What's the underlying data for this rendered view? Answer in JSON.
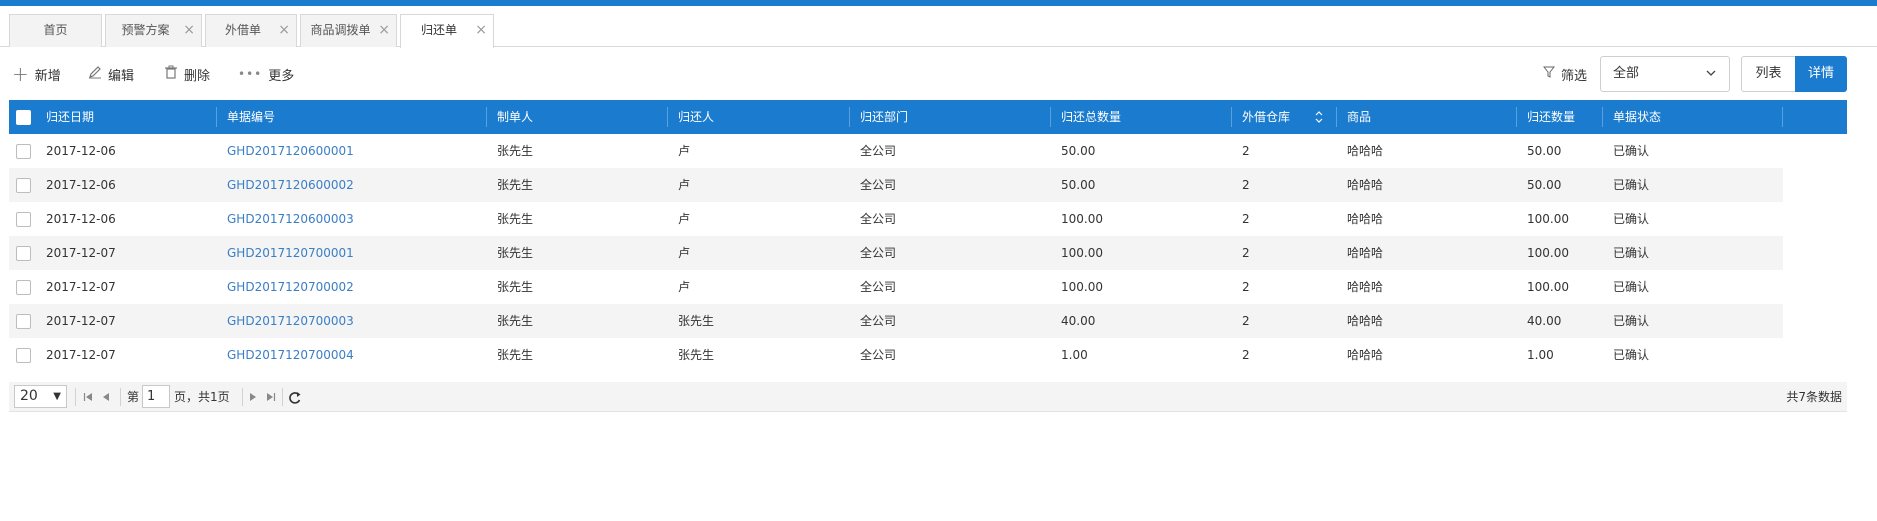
{
  "tabs": [
    {
      "label": "首页",
      "closable": false,
      "active": false
    },
    {
      "label": "预警方案",
      "closable": true,
      "active": false
    },
    {
      "label": "外借单",
      "closable": true,
      "active": false
    },
    {
      "label": "商品调拨单",
      "closable": true,
      "active": false
    },
    {
      "label": "归还单",
      "closable": true,
      "active": true
    }
  ],
  "toolbar": {
    "add_label": "新增",
    "edit_label": "编辑",
    "delete_label": "删除",
    "more_label": "更多",
    "filter_label": "筛选",
    "scope_value": "全部",
    "list_view_label": "列表",
    "detail_view_label": "详情"
  },
  "table": {
    "columns": [
      "归还日期",
      "单据编号",
      "制单人",
      "归还人",
      "归还部门",
      "归还总数量",
      "外借仓库",
      "商品",
      "归还数量",
      "单据状态"
    ],
    "sorted_column": "外借仓库",
    "rows": [
      [
        "2017-12-06",
        "GHD2017120600001",
        "张先生",
        "卢",
        "全公司",
        "50.00",
        "2",
        "哈哈哈",
        "50.00",
        "已确认"
      ],
      [
        "2017-12-06",
        "GHD2017120600002",
        "张先生",
        "卢",
        "全公司",
        "50.00",
        "2",
        "哈哈哈",
        "50.00",
        "已确认"
      ],
      [
        "2017-12-06",
        "GHD2017120600003",
        "张先生",
        "卢",
        "全公司",
        "100.00",
        "2",
        "哈哈哈",
        "100.00",
        "已确认"
      ],
      [
        "2017-12-07",
        "GHD2017120700001",
        "张先生",
        "卢",
        "全公司",
        "100.00",
        "2",
        "哈哈哈",
        "100.00",
        "已确认"
      ],
      [
        "2017-12-07",
        "GHD2017120700002",
        "张先生",
        "卢",
        "全公司",
        "100.00",
        "2",
        "哈哈哈",
        "100.00",
        "已确认"
      ],
      [
        "2017-12-07",
        "GHD2017120700003",
        "张先生",
        "张先生",
        "全公司",
        "40.00",
        "2",
        "哈哈哈",
        "40.00",
        "已确认"
      ],
      [
        "2017-12-07",
        "GHD2017120700004",
        "张先生",
        "张先生",
        "全公司",
        "1.00",
        "2",
        "哈哈哈",
        "1.00",
        "已确认"
      ]
    ]
  },
  "pager": {
    "page_size": "20",
    "page_prefix": "第",
    "current_page": "1",
    "page_suffix": "页，共1页",
    "total_text": "共7条数据"
  },
  "colors": {
    "accent": "#1a7bcf",
    "link": "#3a7ec6",
    "row_alt": "#f4f4f4"
  }
}
